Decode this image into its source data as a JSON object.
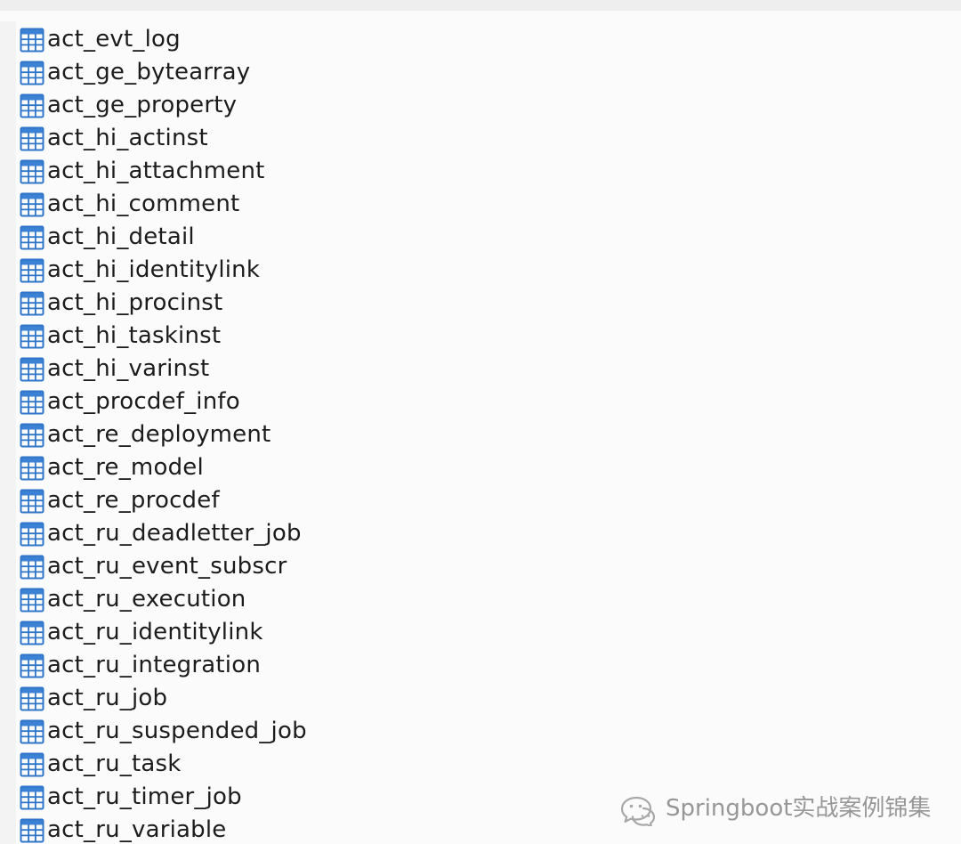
{
  "tables": [
    {
      "name": "act_evt_log",
      "icon": "table-grid-icon"
    },
    {
      "name": "act_ge_bytearray",
      "icon": "table-grid-icon"
    },
    {
      "name": "act_ge_property",
      "icon": "table-grid-icon"
    },
    {
      "name": "act_hi_actinst",
      "icon": "table-grid-icon"
    },
    {
      "name": "act_hi_attachment",
      "icon": "table-grid-icon"
    },
    {
      "name": "act_hi_comment",
      "icon": "table-grid-icon"
    },
    {
      "name": "act_hi_detail",
      "icon": "table-grid-icon"
    },
    {
      "name": "act_hi_identitylink",
      "icon": "table-grid-icon"
    },
    {
      "name": "act_hi_procinst",
      "icon": "table-grid-icon"
    },
    {
      "name": "act_hi_taskinst",
      "icon": "table-grid-icon"
    },
    {
      "name": "act_hi_varinst",
      "icon": "table-grid-icon"
    },
    {
      "name": "act_procdef_info",
      "icon": "table-grid-icon"
    },
    {
      "name": "act_re_deployment",
      "icon": "table-grid-icon"
    },
    {
      "name": "act_re_model",
      "icon": "table-grid-icon"
    },
    {
      "name": "act_re_procdef",
      "icon": "table-grid-icon"
    },
    {
      "name": "act_ru_deadletter_job",
      "icon": "table-grid-icon"
    },
    {
      "name": "act_ru_event_subscr",
      "icon": "table-grid-icon"
    },
    {
      "name": "act_ru_execution",
      "icon": "table-grid-icon"
    },
    {
      "name": "act_ru_identitylink",
      "icon": "table-grid-icon"
    },
    {
      "name": "act_ru_integration",
      "icon": "table-grid-icon"
    },
    {
      "name": "act_ru_job",
      "icon": "table-grid-icon"
    },
    {
      "name": "act_ru_suspended_job",
      "icon": "table-grid-icon"
    },
    {
      "name": "act_ru_task",
      "icon": "table-grid-icon"
    },
    {
      "name": "act_ru_timer_job",
      "icon": "table-grid-icon"
    },
    {
      "name": "act_ru_variable",
      "icon": "table-grid-icon"
    }
  ],
  "watermark": {
    "text": "Springboot实战案例锦集",
    "icon": "wechat-chat-icon"
  },
  "colors": {
    "icon_blue": "#2f76c8",
    "icon_header": "#3b82d4",
    "icon_fill": "#ffffff",
    "text": "#1c1c1c",
    "watermark": "#8f8f8f"
  }
}
